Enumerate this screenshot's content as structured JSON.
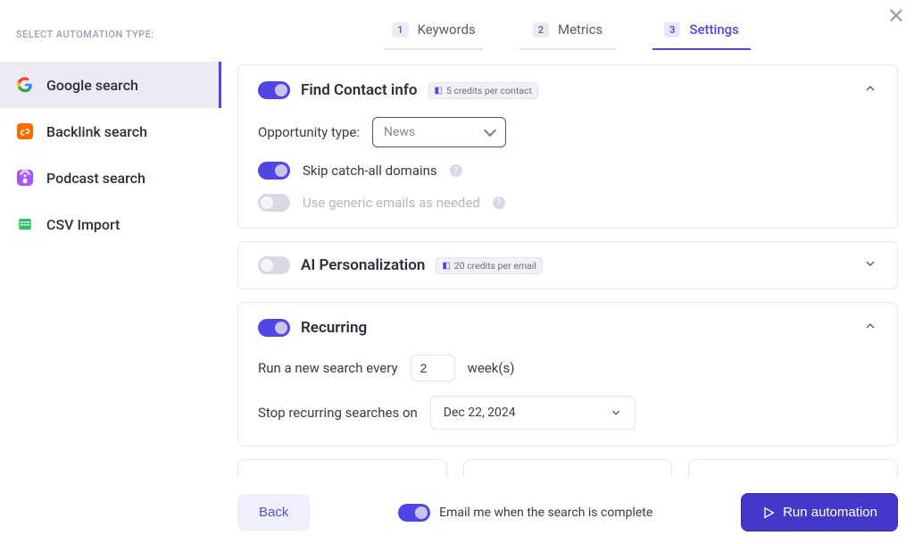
{
  "sidebar": {
    "title": "SELECT AUTOMATION TYPE:",
    "items": [
      {
        "label": "Google search",
        "active": true
      },
      {
        "label": "Backlink search"
      },
      {
        "label": "Podcast search"
      },
      {
        "label": "CSV Import"
      }
    ]
  },
  "stepper": [
    {
      "num": "1",
      "label": "Keywords"
    },
    {
      "num": "2",
      "label": "Metrics"
    },
    {
      "num": "3",
      "label": "Settings",
      "active": true
    }
  ],
  "sections": {
    "findContact": {
      "title": "Find Contact info",
      "badge": "5 credits per contact",
      "opportunityLabel": "Opportunity type:",
      "opportunityValue": "News",
      "skipCatchAll": "Skip catch-all domains",
      "useGeneric": "Use generic emails as needed"
    },
    "aiPersonalization": {
      "title": "AI Personalization",
      "badge": "20 credits per email"
    },
    "recurring": {
      "title": "Recurring",
      "runLabel": "Run a new search every",
      "runValue": "2",
      "runUnit": "week(s)",
      "stopLabel": "Stop recurring searches on",
      "stopDate": "Dec 22, 2024"
    }
  },
  "footer": {
    "back": "Back",
    "emailMe": "Email me when the search is complete",
    "run": "Run automation"
  }
}
